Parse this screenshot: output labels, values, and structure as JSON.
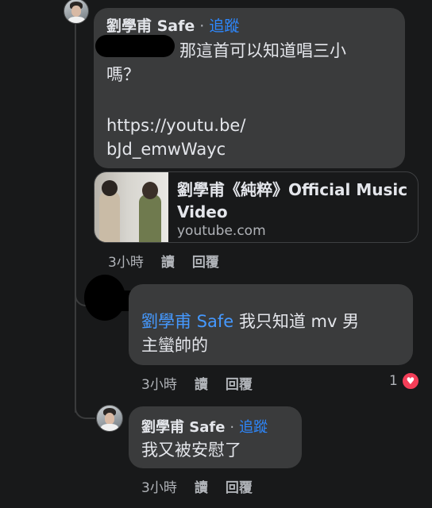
{
  "comment1": {
    "author": "劉學甫 Safe",
    "dot": "·",
    "follow": "追蹤",
    "text_line1": "那這首可以知道唱三小",
    "text_line2": "嗎？",
    "link_line1": "https://youtu.be/",
    "link_line2": "bJd_emwWayc",
    "card": {
      "title": "劉學甫《純粹》Official Music Video",
      "domain": "youtube.com"
    },
    "actions": {
      "time": "3小時",
      "read": "讀",
      "reply": "回覆"
    }
  },
  "reply1": {
    "mention": "劉學甫 Safe",
    "text_part1": " 我只知道 mv 男",
    "text_line2": "主蠻帥的",
    "actions": {
      "time": "3小時",
      "read": "讀",
      "reply": "回覆"
    },
    "reaction_count": "1",
    "reaction_icon": "heart-icon"
  },
  "reply2": {
    "author": "劉學甫 Safe",
    "dot": "·",
    "follow": "追蹤",
    "text": "我又被安慰了",
    "actions": {
      "time": "3小時",
      "read": "讀",
      "reply": "回覆"
    }
  },
  "colors": {
    "background": "#18191a",
    "bubble": "#3a3b3c",
    "link": "#4599ff",
    "heart": "#f33e58"
  }
}
